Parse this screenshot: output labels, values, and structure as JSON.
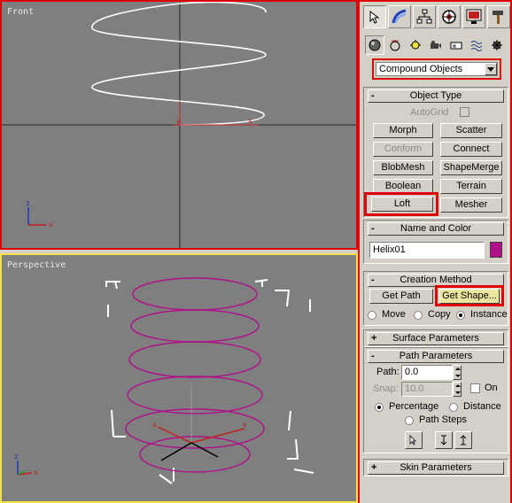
{
  "viewports": {
    "front": {
      "label": "Front"
    },
    "perspective": {
      "label": "Perspective"
    }
  },
  "axes": {
    "x": "x",
    "y": "y",
    "z": "z"
  },
  "command_panel": {
    "tabs": [
      "create-tab",
      "modify-tab",
      "hierarchy-tab",
      "motion-tab",
      "display-tab",
      "utilities-tab"
    ],
    "subtabs": [
      "geometry",
      "shapes",
      "lights",
      "cameras",
      "helpers",
      "spacewarps",
      "systems"
    ],
    "category_dropdown": "Compound Objects",
    "object_type": {
      "title": "Object Type",
      "autogrid": "AutoGrid",
      "buttons": [
        "Morph",
        "Scatter",
        "Conform",
        "Connect",
        "BlobMesh",
        "ShapeMerge",
        "Boolean",
        "Terrain",
        "Loft",
        "Mesher"
      ]
    },
    "name_and_color": {
      "title": "Name and Color",
      "name": "Helix01",
      "color": "#b0108a"
    },
    "creation_method": {
      "title": "Creation Method",
      "get_path": "Get Path",
      "get_shape": "Get Shape...",
      "move": "Move",
      "copy": "Copy",
      "instance": "Instance",
      "selected": "Instance"
    },
    "surface_parameters": {
      "title": "Surface Parameters"
    },
    "path_parameters": {
      "title": "Path Parameters",
      "path_label": "Path:",
      "path_value": "0.0",
      "snap_label": "Snap:",
      "snap_value": "10.0",
      "on_label": "On",
      "percentage": "Percentage",
      "distance": "Distance",
      "path_steps": "Path Steps",
      "selected": "Percentage"
    },
    "skin_parameters": {
      "title": "Skin Parameters"
    },
    "rollout_signs": {
      "open": "-",
      "closed": "+"
    }
  },
  "colors": {
    "highlight": "#e00000",
    "active_viewport": "#f3e04a",
    "helix_front": "#ffffff",
    "helix_perspective": "#b0108a"
  }
}
